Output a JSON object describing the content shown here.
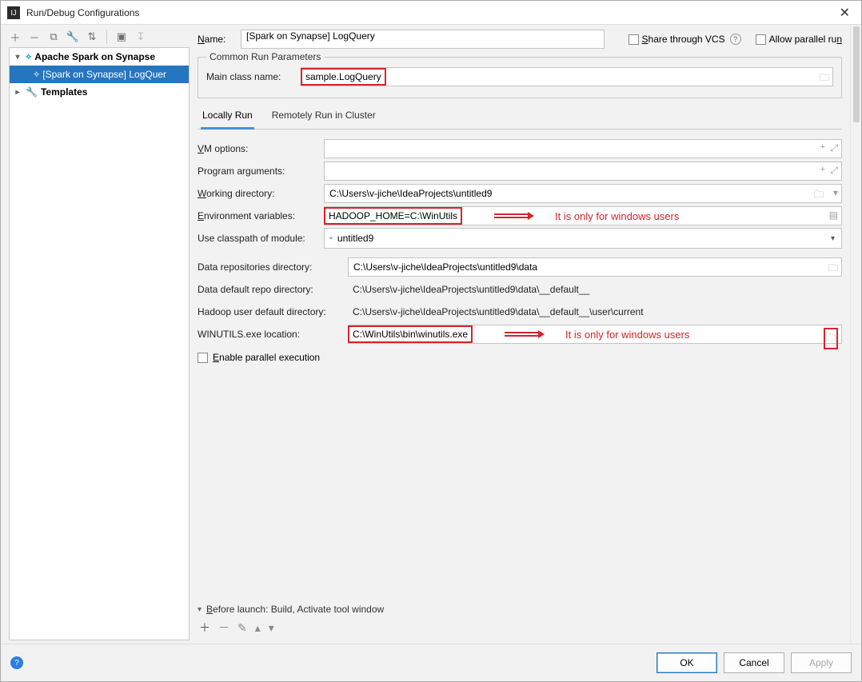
{
  "window": {
    "title": "Run/Debug Configurations"
  },
  "tree": {
    "root1": "Apache Spark on Synapse",
    "item1": "[Spark on Synapse] LogQuer",
    "root2": "Templates"
  },
  "name": {
    "label": "Name:",
    "value": "[Spark on Synapse] LogQuery"
  },
  "shareVcs": "Share through VCS",
  "allowParallel": "Allow parallel run",
  "commonParams": {
    "legend": "Common Run Parameters",
    "mainClassLabel": "Main class name:",
    "mainClassValue": "sample.LogQuery"
  },
  "tabs": {
    "local": "Locally Run",
    "remote": "Remotely Run in Cluster"
  },
  "form": {
    "vmOptionsLabel": "VM options:",
    "programArgsLabel": "Program arguments:",
    "workingDirLabel": "Working directory:",
    "workingDirValue": "C:\\Users\\v-jiche\\IdeaProjects\\untitled9",
    "envVarsLabel": "Environment variables:",
    "envVarsValue": "HADOOP_HOME=C:\\WinUtils",
    "useCpLabel": "Use classpath of module:",
    "useCpValue": "untitled9",
    "dataReposLabel": "Data repositories directory:",
    "dataReposValue": "C:\\Users\\v-jiche\\IdeaProjects\\untitled9\\data",
    "dataDefaultRepoLabel": "Data default repo directory:",
    "dataDefaultRepoValue": "C:\\Users\\v-jiche\\IdeaProjects\\untitled9\\data\\__default__",
    "hadoopUserLabel": "Hadoop user default directory:",
    "hadoopUserValue": "C:\\Users\\v-jiche\\IdeaProjects\\untitled9\\data\\__default__\\user\\current",
    "winutilsLabel": "WINUTILS.exe location:",
    "winutilsValue": "C:\\WinUtils\\bin\\winutils.exe",
    "enableParallel": "Enable parallel execution"
  },
  "annot": "It is only for windows users",
  "beforeLaunch": {
    "label": "Before launch: Build, Activate tool window"
  },
  "footer": {
    "ok": "OK",
    "cancel": "Cancel",
    "apply": "Apply"
  }
}
